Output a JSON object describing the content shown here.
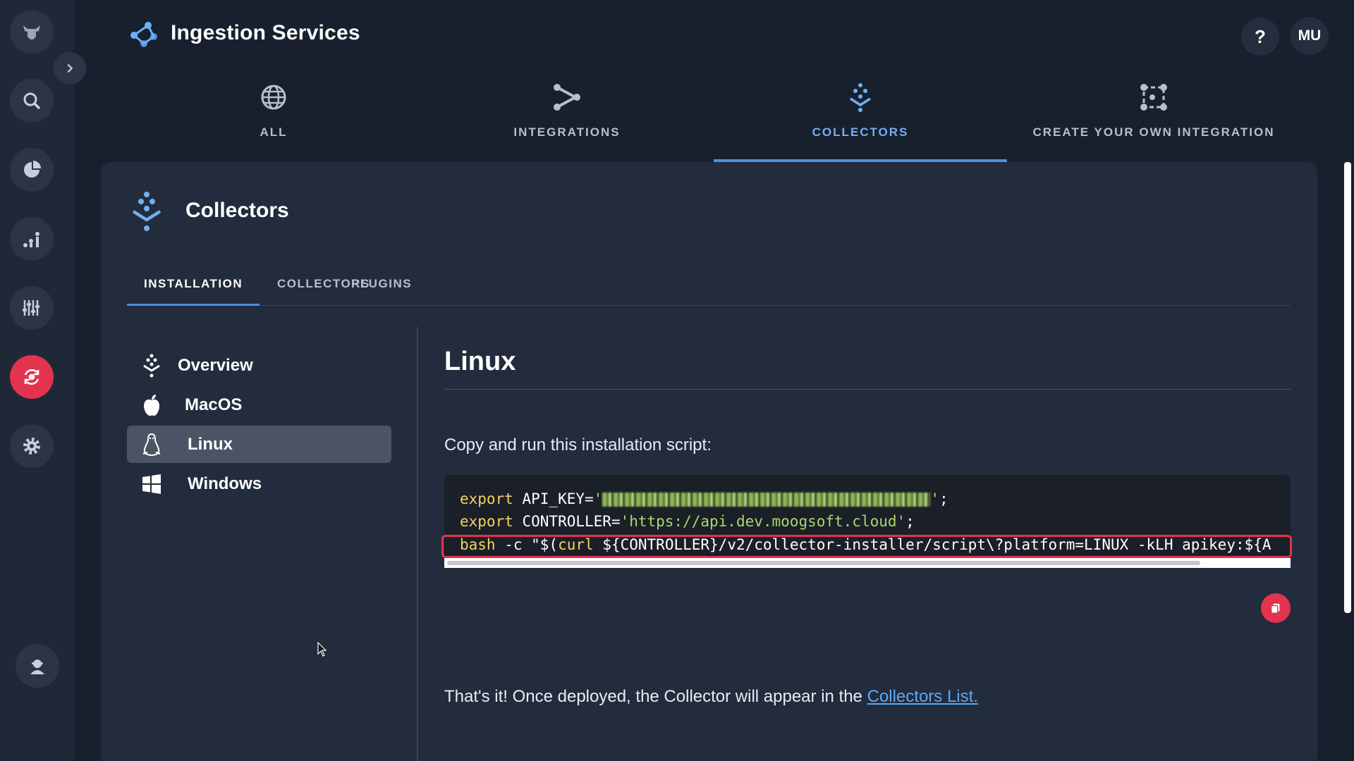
{
  "header": {
    "title": "Ingestion Services",
    "help_label": "?",
    "user_initials": "MU"
  },
  "top_tabs": [
    {
      "label": "ALL",
      "icon": "globe-icon"
    },
    {
      "label": "INTEGRATIONS",
      "icon": "integrations-icon"
    },
    {
      "label": "COLLECTORS",
      "icon": "collectors-icon",
      "active": true
    },
    {
      "label": "CREATE YOUR OWN INTEGRATION",
      "icon": "custom-integration-icon"
    }
  ],
  "rail": {
    "items": [
      "logo-icon",
      "search-icon",
      "pie-chart-icon",
      "analytics-icon",
      "sliders-icon",
      "sync-icon",
      "settings-icon"
    ],
    "bottom_item": "agent-icon",
    "active_item": "sync-icon"
  },
  "panel": {
    "title": "Collectors",
    "sub_tabs": [
      {
        "label": "INSTALLATION",
        "active": true
      },
      {
        "label": "COLLECTORS"
      },
      {
        "label": "PLUGINS"
      }
    ],
    "os_list": [
      {
        "label": "Overview",
        "icon": "collectors-icon"
      },
      {
        "label": "MacOS",
        "icon": "apple-icon"
      },
      {
        "label": "Linux",
        "icon": "linux-icon",
        "selected": true
      },
      {
        "label": "Windows",
        "icon": "windows-icon"
      }
    ]
  },
  "content": {
    "title": "Linux",
    "instruction": "Copy and run this installation script:",
    "code": {
      "line1_kw": "export",
      "line1_var": " API_KEY=",
      "line1_end": ";",
      "line2_kw": "export",
      "line2_var": " CONTROLLER=",
      "line2_str": "'https://api.dev.moogsoft.cloud'",
      "line2_end": ";",
      "line3_kw": "bash",
      "line3_mid": " -c \"$(",
      "line3_curl": "curl",
      "line3_rest": " ${CONTROLLER}/v2/collector-installer/script\\?platform=LINUX -kLH apikey:${A"
    },
    "footer_text": "That's it! Once deployed, the Collector will appear in the ",
    "footer_link": "Collectors List."
  },
  "colors": {
    "accent": "#4f8fe0",
    "danger": "#e3334f",
    "background": "#18202e",
    "panel": "#222c3c"
  }
}
